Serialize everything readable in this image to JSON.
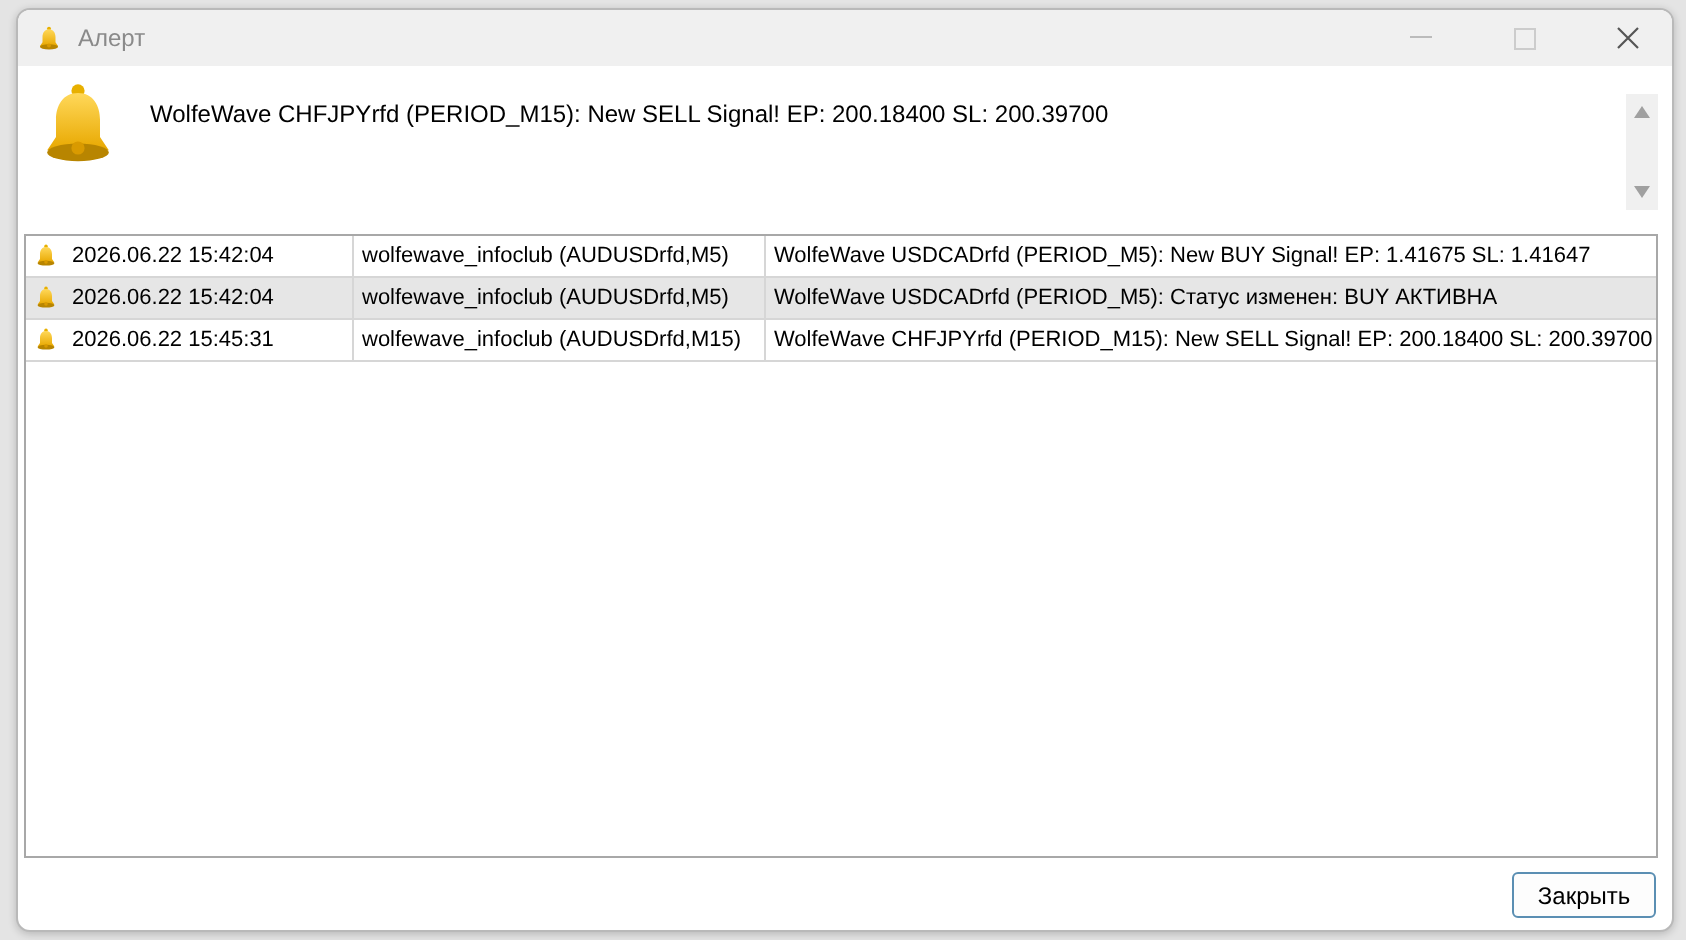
{
  "window": {
    "title": "Алерт"
  },
  "message": "WolfeWave CHFJPYrfd (PERIOD_M15): New SELL Signal! EP: 200.18400 SL: 200.39700",
  "alerts": [
    {
      "time": "2026.06.22 15:42:04",
      "source": "wolfewave_infoclub (AUDUSDrfd,M5)",
      "message": "WolfeWave USDCADrfd (PERIOD_M5): New BUY Signal! EP: 1.41675 SL: 1.41647",
      "selected": false
    },
    {
      "time": "2026.06.22 15:42:04",
      "source": "wolfewave_infoclub (AUDUSDrfd,M5)",
      "message": "WolfeWave USDCADrfd (PERIOD_M5): Статус изменен: BUY АКТИВНА",
      "selected": true
    },
    {
      "time": "2026.06.22 15:45:31",
      "source": "wolfewave_infoclub (AUDUSDrfd,M15)",
      "message": "WolfeWave CHFJPYrfd (PERIOD_M15): New SELL Signal! EP: 200.18400 SL: 200.39700",
      "selected": false
    }
  ],
  "buttons": [
    {
      "label": "Закрыть"
    }
  ]
}
